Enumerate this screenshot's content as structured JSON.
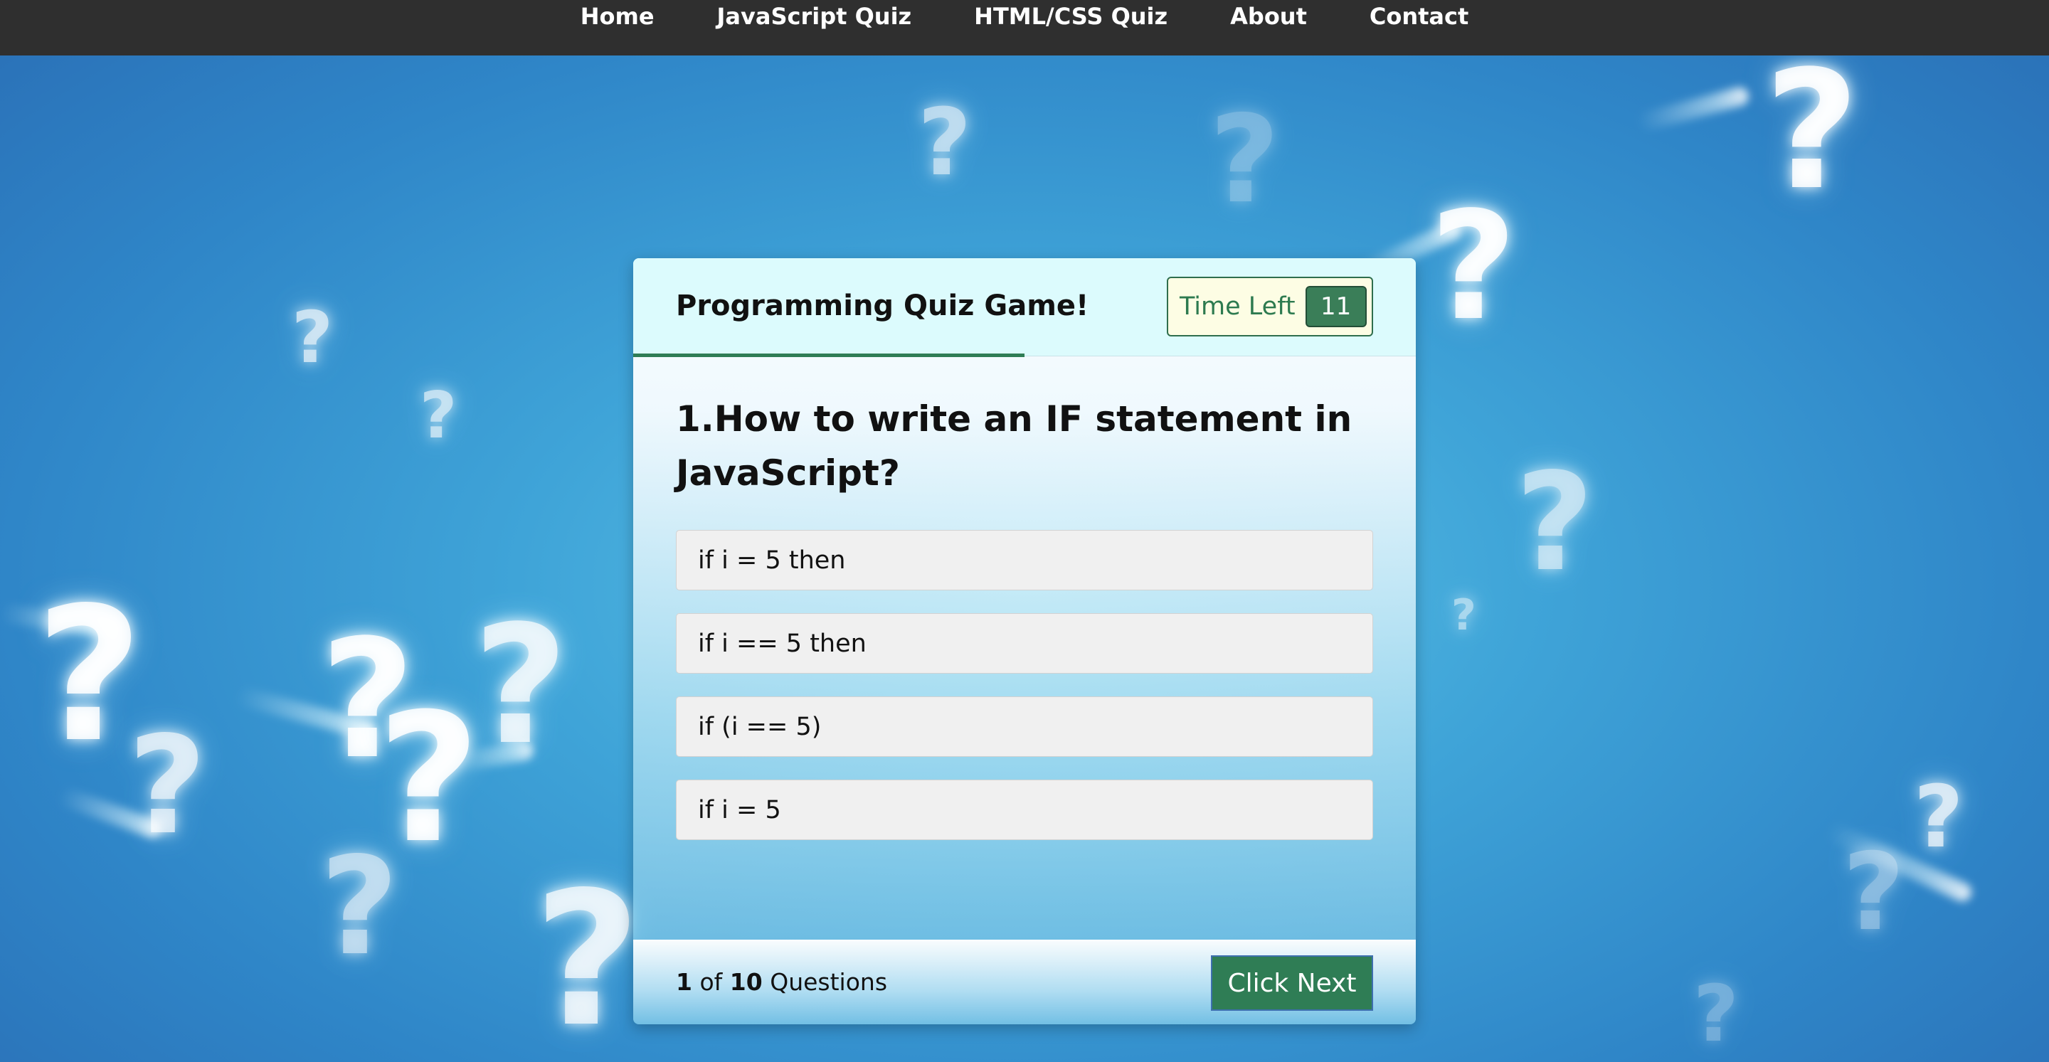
{
  "nav": {
    "items": [
      {
        "label": "Home"
      },
      {
        "label": "JavaScript Quiz"
      },
      {
        "label": "HTML/CSS Quiz"
      },
      {
        "label": "About"
      },
      {
        "label": "Contact"
      }
    ]
  },
  "quiz": {
    "title": "Programming Quiz Game!",
    "timer": {
      "label": "Time Left",
      "value": "11"
    },
    "header_progress_fraction": 0.5,
    "question": "1.How to write an IF statement in JavaScript?",
    "options": [
      {
        "label": "if i = 5 then"
      },
      {
        "label": "if i == 5 then"
      },
      {
        "label": "if (i == 5)"
      },
      {
        "label": "if i = 5"
      }
    ],
    "footer": {
      "current": "1",
      "of_text": "of",
      "total": "10",
      "questions_text": "Questions",
      "next_label": "Click Next"
    }
  },
  "colors": {
    "accent_green": "#2f7d55",
    "nav_bg": "#2f2f2f",
    "header_bg": "#dcfbfd"
  },
  "background_icon": "question-mark-icon"
}
